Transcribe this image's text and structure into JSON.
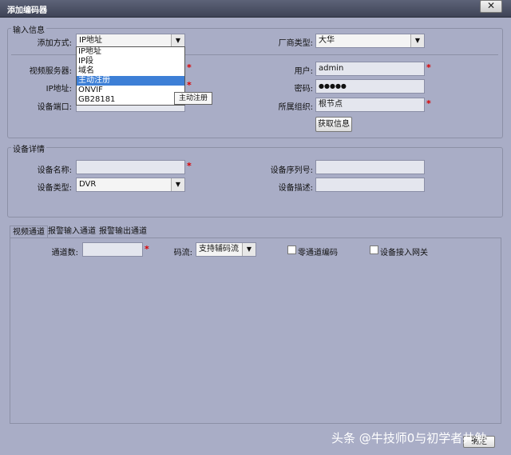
{
  "window": {
    "title": "添加编码器",
    "close_label": "✕"
  },
  "input_info": {
    "title": "输入信息",
    "add_mode_label": "添加方式:",
    "add_mode_value": "IP地址",
    "vendor_label": "厂商类型:",
    "vendor_value": "大华",
    "video_server_label": "视频服务器:",
    "ip_label": "IP地址:",
    "port_label": "设备端口:",
    "user_label": "用户:",
    "user_value": "admin",
    "password_label": "密码:",
    "password_value": "●●●●●",
    "org_label": "所属组织:",
    "org_value": "根节点",
    "fetch_button": "获取信息"
  },
  "dropdown": {
    "items": [
      "IP地址",
      "IP段",
      "域名",
      "主动注册",
      "ONVIF",
      "GB28181"
    ],
    "highlighted_index": 3,
    "tooltip": "主动注册"
  },
  "device_details": {
    "title": "设备详情",
    "name_label": "设备名称:",
    "serial_label": "设备序列号:",
    "type_label": "设备类型:",
    "type_value": "DVR",
    "desc_label": "设备描述:"
  },
  "tabs": {
    "items": [
      "视频通道",
      "报警输入通道",
      "报警输出通道"
    ],
    "active_index": 0
  },
  "video_channel": {
    "channel_count_label": "通道数:",
    "stream_label": "码流:",
    "stream_value": "支持辅码流",
    "zero_channel_label": "零通道编码",
    "gateway_label": "设备接入网关"
  },
  "footer": {
    "watermark": "头条 @牛技师0与初学者共勉",
    "ok_button": "确定"
  },
  "required_mark": "*"
}
